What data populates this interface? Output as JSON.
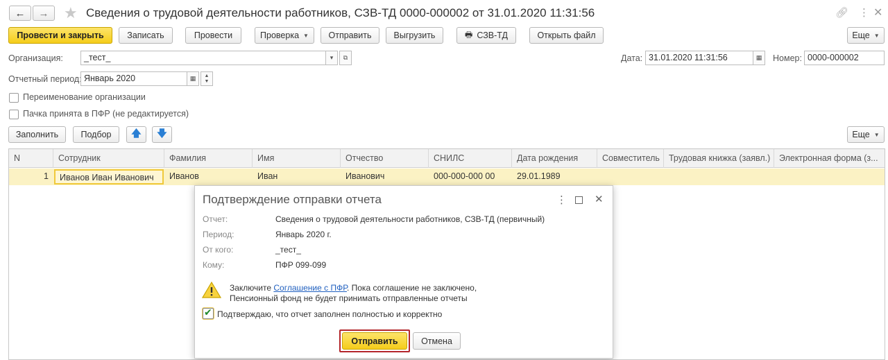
{
  "window": {
    "title": "Сведения о трудовой деятельности работников, СЗВ-ТД 0000-000002 от 31.01.2020 11:31:56"
  },
  "toolbar": {
    "post_close": "Провести и закрыть",
    "save": "Записать",
    "post": "Провести",
    "check": "Проверка",
    "send": "Отправить",
    "upload": "Выгрузить",
    "szvtd": "СЗВ-ТД",
    "open_file": "Открыть файл",
    "more": "Еще"
  },
  "form": {
    "org_label": "Организация:",
    "org_value": "_тест_",
    "date_label": "Дата:",
    "date_value": "31.01.2020 11:31:56",
    "number_label": "Номер:",
    "number_value": "0000-000002",
    "period_label": "Отчетный период:",
    "period_value": "Январь 2020",
    "rename_org": "Переименование организации",
    "accepted_pfr": "Пачка принята в ПФР (не редактируется)"
  },
  "table_toolbar": {
    "fill": "Заполнить",
    "select": "Подбор",
    "more": "Еще"
  },
  "table": {
    "headers": [
      "N",
      "Сотрудник",
      "Фамилия",
      "Имя",
      "Отчество",
      "СНИЛС",
      "Дата рождения",
      "Совместитель",
      "Трудовая книжка (заявл.)",
      "Электронная форма (з..."
    ],
    "rows": [
      [
        "1",
        "Иванов Иван Иванович",
        "Иванов",
        "Иван",
        "Иванович",
        "000-000-000 00",
        "29.01.1989",
        "",
        "",
        ""
      ]
    ]
  },
  "dialog": {
    "title": "Подтверждение отправки отчета",
    "report_label": "Отчет:",
    "report_value": "Сведения о трудовой деятельности работников, СЗВ-ТД (первичный)",
    "period_label": "Период:",
    "period_value": "Январь 2020 г.",
    "from_label": "От кого:",
    "from_value": "_тест_",
    "to_label": "Кому:",
    "to_value": "ПФР 099-099",
    "warning_prefix": "Заключите ",
    "warning_link": "Соглашение с ПФР",
    "warning_suffix": ". Пока соглашение не заключено,",
    "warning_line2": "Пенсионный фонд не будет принимать отправленные отчеты",
    "confirm": "Подтверждаю, что отчет заполнен полностью и корректно",
    "send": "Отправить",
    "cancel": "Отмена"
  },
  "colors": {
    "accent_yellow": "#f5cd1a",
    "selected_row": "#fbf2c4",
    "highlight_red": "#c0392b",
    "link_blue": "#1f5fbf"
  }
}
